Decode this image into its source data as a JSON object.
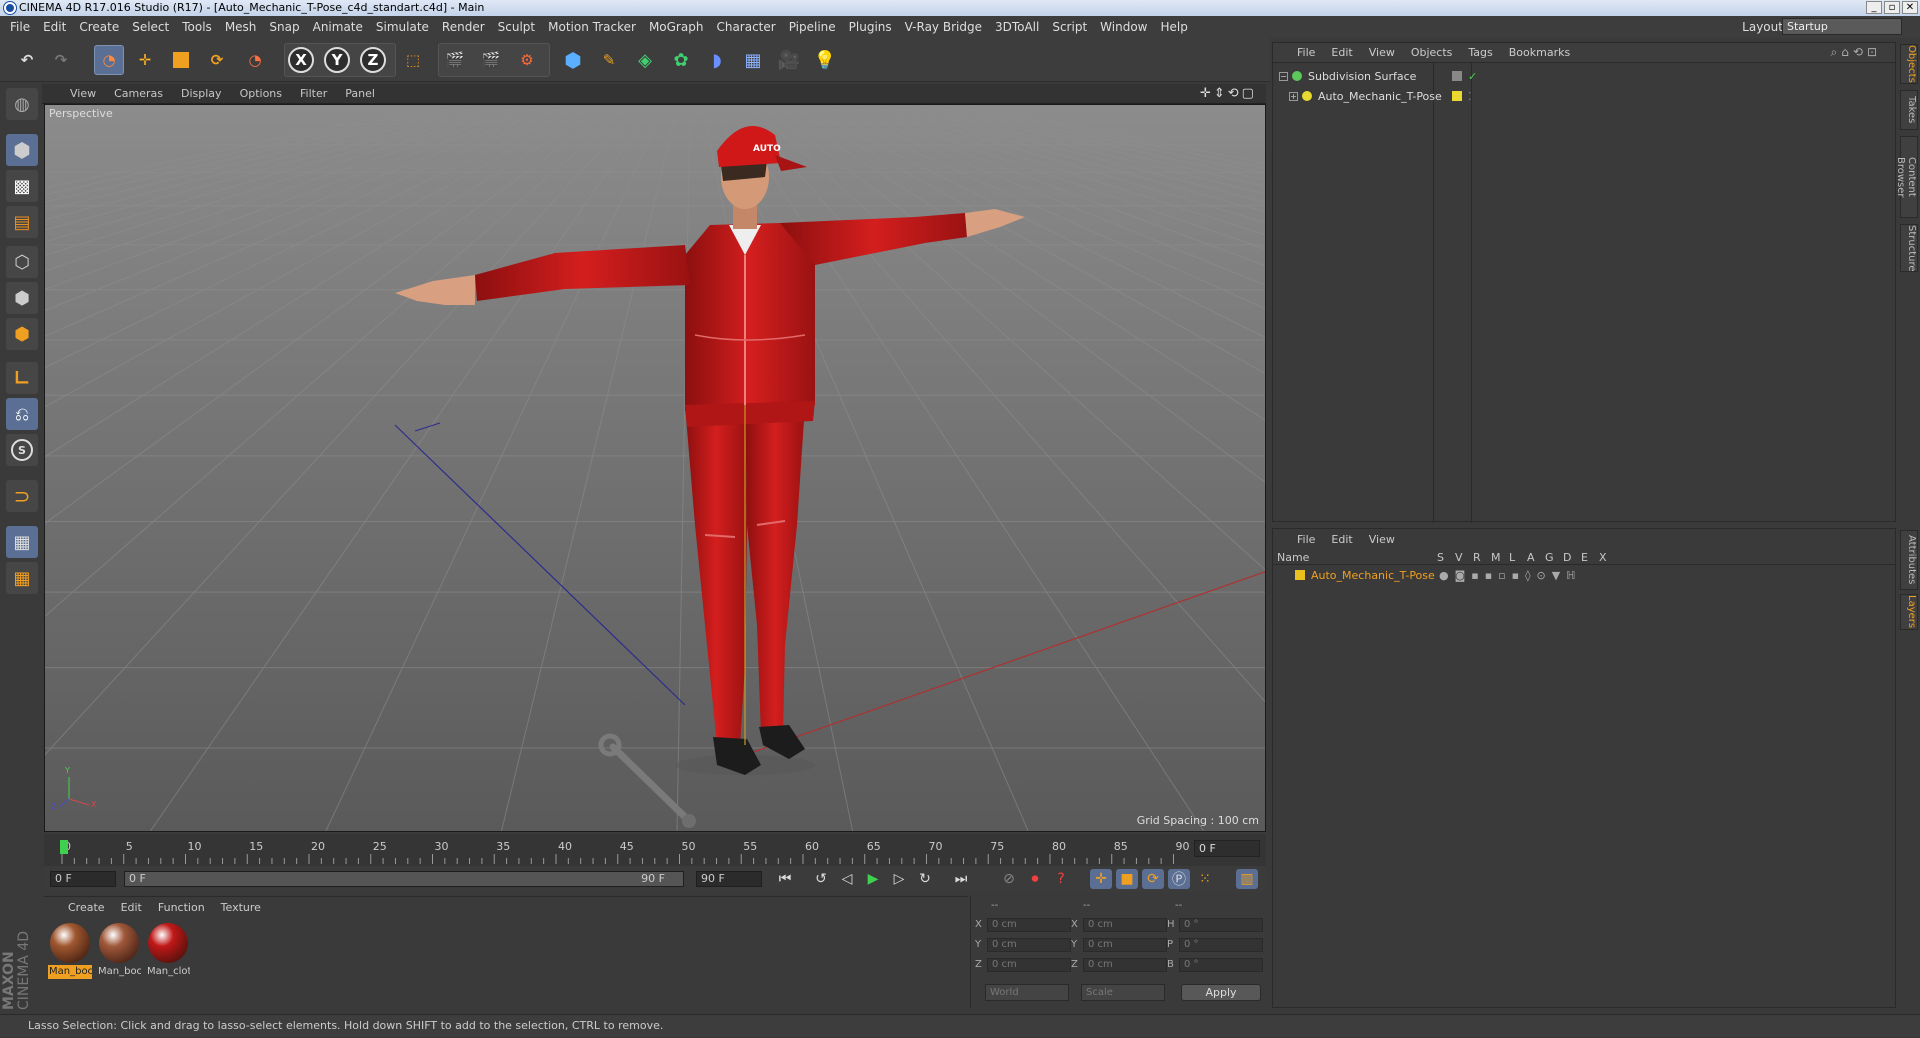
{
  "window": {
    "title": "CINEMA 4D R17.016 Studio (R17) - [Auto_Mechanic_T-Pose_c4d_standart.c4d] - Main"
  },
  "menubar": {
    "items": [
      "File",
      "Edit",
      "Create",
      "Select",
      "Tools",
      "Mesh",
      "Snap",
      "Animate",
      "Simulate",
      "Render",
      "Sculpt",
      "Motion Tracker",
      "MoGraph",
      "Character",
      "Pipeline",
      "Plugins",
      "V-Ray Bridge",
      "3DToAll",
      "Script",
      "Window",
      "Help"
    ]
  },
  "layout": {
    "label": "Layout:",
    "value": "Startup"
  },
  "viewport": {
    "menu": [
      "View",
      "Cameras",
      "Display",
      "Options",
      "Filter",
      "Panel"
    ],
    "camera_label": "Perspective",
    "grid_spacing": "Grid Spacing : 100 cm",
    "cap_text": "AUTO"
  },
  "timeline": {
    "ticks": [
      "0",
      "5",
      "10",
      "15",
      "20",
      "25",
      "30",
      "35",
      "40",
      "45",
      "50",
      "55",
      "60",
      "65",
      "70",
      "75",
      "80",
      "85",
      "90"
    ],
    "current_frame": "0 F",
    "start_field": "0 F",
    "range_start": "0 F",
    "range_end": "90 F",
    "end_field": "90 F"
  },
  "material_manager": {
    "menu": [
      "Create",
      "Edit",
      "Function",
      "Texture"
    ],
    "materials": [
      {
        "label": "Man_boc",
        "color": "#a0572f",
        "selected": true
      },
      {
        "label": "Man_boc",
        "color": "#a0583a",
        "selected": false
      },
      {
        "label": "Man_clot",
        "color": "#c01818",
        "selected": false
      }
    ]
  },
  "coordinates": {
    "headers": [
      "--",
      "--",
      "--"
    ],
    "rows": [
      {
        "a": "X",
        "av": "0 cm",
        "b": "X",
        "bv": "0 cm",
        "c": "H",
        "cv": "0 °"
      },
      {
        "a": "Y",
        "av": "0 cm",
        "b": "Y",
        "bv": "0 cm",
        "c": "P",
        "cv": "0 °"
      },
      {
        "a": "Z",
        "av": "0 cm",
        "b": "Z",
        "bv": "0 cm",
        "c": "B",
        "cv": "0 °"
      }
    ],
    "mode1": "World",
    "mode2": "Scale",
    "apply": "Apply"
  },
  "object_manager": {
    "menu": [
      "File",
      "Edit",
      "View",
      "Objects",
      "Tags",
      "Bookmarks"
    ],
    "objects": [
      {
        "name": "Subdivision Surface",
        "icon_color": "#5cc85c"
      },
      {
        "name": "Auto_Mechanic_T-Pose",
        "icon_color": "#e8d830"
      }
    ]
  },
  "layer_manager": {
    "menu": [
      "File",
      "Edit",
      "View"
    ],
    "name_header": "Name",
    "columns": [
      "S",
      "V",
      "R",
      "M",
      "L",
      "A",
      "G",
      "D",
      "E",
      "X"
    ],
    "layers": [
      {
        "name": "Auto_Mechanic_T-Pose",
        "color": "#e8c020"
      }
    ]
  },
  "right_tabs": [
    "Objects",
    "Takes",
    "Content Browser",
    "Structure",
    "Attributes",
    "Layers"
  ],
  "statusbar": {
    "text": "Lasso Selection: Click and drag to lasso-select elements. Hold down SHIFT to add to the selection, CTRL to remove."
  },
  "brand": {
    "line1": "MAXON",
    "line2": "CINEMA 4D"
  },
  "colors": {
    "accent": "#5a6f93",
    "character_red": "#c41818",
    "panel_bg": "#3a3a3a"
  }
}
